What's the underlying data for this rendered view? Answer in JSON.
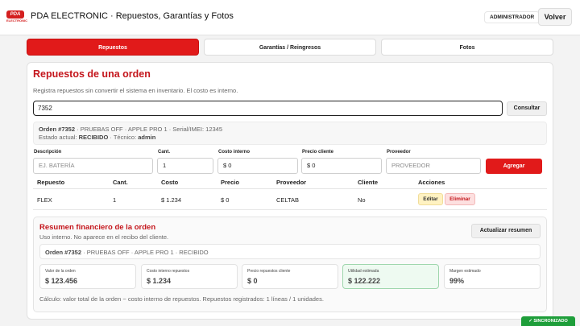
{
  "header": {
    "logo_text": "PDA",
    "logo_sub": "ELECTRONIC",
    "title": "PDA ELECTRONIC · Repuestos, Garantías y Fotos",
    "role": "ADMINISTRADOR",
    "back_label": "Volver"
  },
  "tabs": [
    {
      "label": "Repuestos",
      "active": true
    },
    {
      "label": "Garantías / Reingresos",
      "active": false
    },
    {
      "label": "Fotos",
      "active": false
    }
  ],
  "parts": {
    "title": "Repuestos de una orden",
    "subtitle": "Registra repuestos sin convertir el sistema en inventario. El costo es interno.",
    "search_value": "7352",
    "consult_label": "Consultar",
    "order": {
      "label": "Orden #7352",
      "details": " · PRUEBAS OFF · APPLE PRO 1 · Serial/IMEI: 12345",
      "state_prefix": "Estado actual: ",
      "state": "RECIBIDO",
      "tech_prefix": " · Técnico: ",
      "tech": "admin"
    },
    "form": {
      "desc_label": "Descripción",
      "desc_placeholder": "EJ. BATERÍA",
      "qty_label": "Cant.",
      "qty_value": "1",
      "cost_label": "Costo interno",
      "cost_value": "$ 0",
      "price_label": "Precio cliente",
      "price_value": "$ 0",
      "supplier_label": "Proveedor",
      "supplier_placeholder": "PROVEEDOR",
      "add_label": "Agregar"
    },
    "table": {
      "headers": [
        "Repuesto",
        "Cant.",
        "Costo",
        "Precio",
        "Proveedor",
        "Cliente",
        "Acciones"
      ],
      "rows": [
        {
          "part": "FLEX",
          "qty": "1",
          "cost": "$ 1.234",
          "price": "$ 0",
          "supplier": "CELTAB",
          "client": "No",
          "edit": "Editar",
          "delete": "Eliminar"
        }
      ]
    }
  },
  "summary": {
    "title": "Resumen financiero de la orden",
    "subtitle": "Uso interno. No aparece en el recibo del cliente.",
    "refresh_label": "Actualizar resumen",
    "order_label": "Orden #7352",
    "order_details": " · PRUEBAS OFF · APPLE PRO 1 · RECIBIDO",
    "kpis": [
      {
        "label": "Valor de la orden",
        "value": "$ 123.456"
      },
      {
        "label": "Costo interno repuestos",
        "value": "$ 1.234"
      },
      {
        "label": "Precio repuestos cliente",
        "value": "$ 0"
      },
      {
        "label": "Utilidad estimada",
        "value": "$ 122.222"
      },
      {
        "label": "Margen estimado",
        "value": "99%"
      }
    ],
    "calc": "Cálculo: valor total de la orden − costo interno de repuestos. Repuestos registrados: 1 líneas / 1 unidades."
  },
  "status": {
    "sync": "✓ SINCRONIZADO"
  },
  "colors": {
    "accent": "#e11a1a",
    "title_red": "#c4161c",
    "success": "#1e9e3a"
  }
}
